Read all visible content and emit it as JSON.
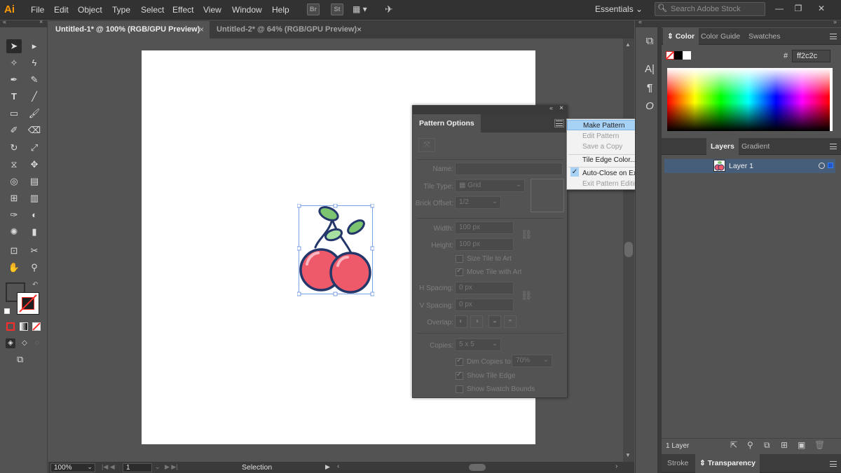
{
  "app": {
    "logo": "Ai"
  },
  "menu": [
    "File",
    "Edit",
    "Object",
    "Type",
    "Select",
    "Effect",
    "View",
    "Window",
    "Help"
  ],
  "menubar_icons": {
    "bridge": "Br",
    "stock": "St"
  },
  "workspace": {
    "label": "Essentials"
  },
  "search": {
    "placeholder": "Search Adobe Stock"
  },
  "tabs": [
    {
      "label": "Untitled-1* @ 100% (RGB/GPU Preview)",
      "active": true
    },
    {
      "label": "Untitled-2* @ 64% (RGB/GPU Preview)",
      "active": false
    }
  ],
  "pattern_options": {
    "title": "Pattern Options",
    "name_label": "Name:",
    "tile_type_label": "Tile Type:",
    "tile_type_value": "Grid",
    "brick_offset_label": "Brick Offset:",
    "brick_offset_value": "1/2",
    "width_label": "Width:",
    "width_value": "100 px",
    "height_label": "Height:",
    "height_value": "100 px",
    "size_tile_label": "Size Tile to Art",
    "move_tile_label": "Move Tile with Art",
    "h_spacing_label": "H Spacing:",
    "h_spacing_value": "0 px",
    "v_spacing_label": "V Spacing:",
    "v_spacing_value": "0 px",
    "overlap_label": "Overlap:",
    "copies_label": "Copies:",
    "copies_value": "5 x 5",
    "dim_copies_label": "Dim Copies to:",
    "dim_copies_value": "70%",
    "show_tile_edge_label": "Show Tile Edge",
    "show_swatch_bounds_label": "Show Swatch Bounds"
  },
  "flyout_menu": {
    "items": [
      {
        "label": "Make Pattern",
        "state": "highlighted"
      },
      {
        "label": "Edit Pattern",
        "state": "disabled"
      },
      {
        "label": "Save a Copy",
        "state": "disabled"
      },
      {
        "label": "Tile Edge Color...",
        "state": "enabled"
      },
      {
        "label": "Auto-Close on Exiting Edit Mode",
        "state": "checked"
      },
      {
        "label": "Exit Pattern Editing Mode",
        "state": "disabled"
      }
    ]
  },
  "color_panel": {
    "tabs": [
      "Color",
      "Color Guide",
      "Swatches"
    ],
    "hex_label": "#",
    "hex_value": "ff2c2c"
  },
  "layers_panel": {
    "tabs": [
      "Layers",
      "Gradient"
    ],
    "layers": [
      {
        "name": "Layer 1"
      }
    ],
    "footer": "1 Layer"
  },
  "bottom_panel": {
    "tabs": [
      "Stroke",
      "Transparency"
    ]
  },
  "status_bar": {
    "zoom": "100%",
    "artboard": "1",
    "mode": "Selection"
  },
  "colors": {
    "accent_highlight": "#a7d1f5",
    "stroke_color": "#ff2c2c",
    "cherry_red": "#ef5a6a",
    "leaf_green": "#7cc46f"
  }
}
